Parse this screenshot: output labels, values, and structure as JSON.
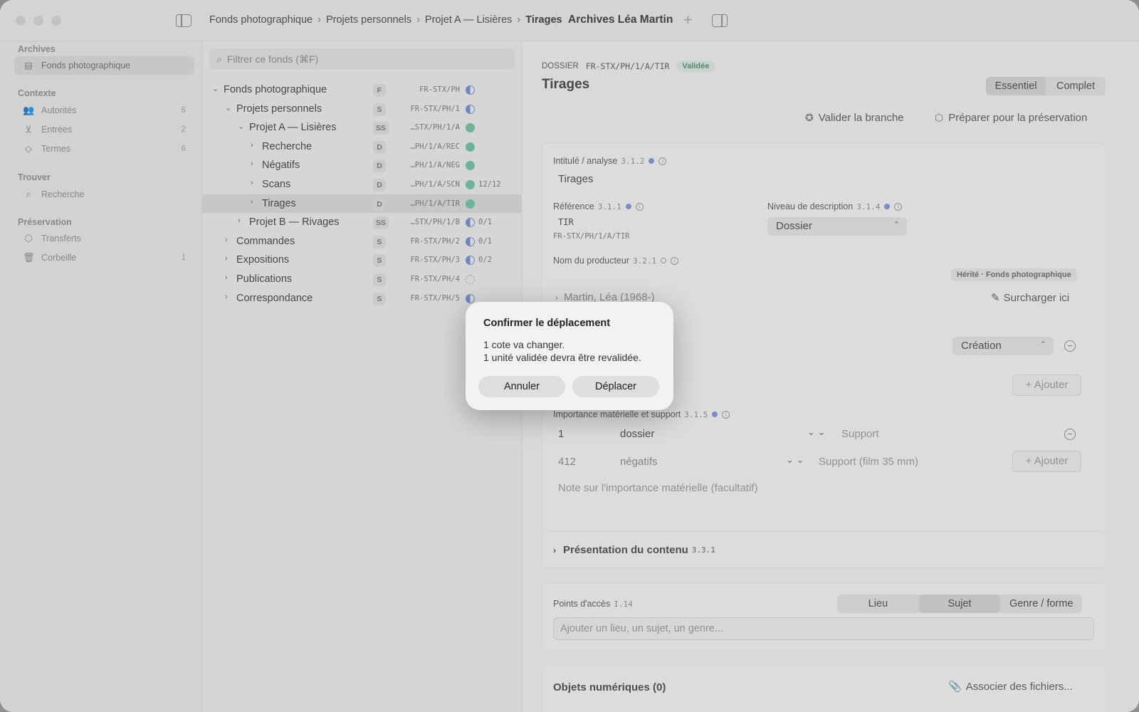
{
  "titlebar": {
    "breadcrumb": [
      "Fonds photographique",
      "Projets personnels",
      "Projet A — Lisières",
      "Tirages"
    ],
    "document_title": "Archives Léa Martin",
    "add_label": "+"
  },
  "sidebar": {
    "sections": [
      {
        "heading": "Archives",
        "items": [
          {
            "label": "Fonds photographique",
            "icon": "archive-box-icon",
            "count": "",
            "selected": true
          }
        ]
      },
      {
        "heading": "Contexte",
        "items": [
          {
            "label": "Autorités",
            "icon": "people-icon",
            "count": "6"
          },
          {
            "label": "Entrées",
            "icon": "inbox-tray-icon",
            "count": "2"
          },
          {
            "label": "Termes",
            "icon": "tag-icon",
            "count": "6"
          }
        ]
      },
      {
        "heading": "Trouver",
        "items": [
          {
            "label": "Recherche",
            "icon": "search-icon",
            "count": ""
          }
        ]
      },
      {
        "heading": "Préservation",
        "items": [
          {
            "label": "Transferts",
            "icon": "package-icon",
            "count": ""
          },
          {
            "label": "Corbeille",
            "icon": "trash-icon",
            "count": "1"
          }
        ]
      }
    ]
  },
  "tree": {
    "filter_placeholder": "Filtrer ce fonds (⌘F)",
    "rows": [
      {
        "label": "Fonds photographique",
        "level": "F",
        "cote": "FR-STX/PH",
        "status": "half",
        "progress": "",
        "depth": 0,
        "open": true
      },
      {
        "label": "Projets personnels",
        "level": "S",
        "cote": "FR-STX/PH/1",
        "status": "half",
        "progress": "",
        "depth": 1,
        "open": true
      },
      {
        "label": "Projet A — Lisières",
        "level": "SS",
        "cote": "…STX/PH/1/A",
        "status": "ok",
        "progress": "",
        "depth": 2,
        "open": true
      },
      {
        "label": "Recherche",
        "level": "D",
        "cote": "…PH/1/A/REC",
        "status": "ok",
        "progress": "",
        "depth": 3,
        "open": false
      },
      {
        "label": "Négatifs",
        "level": "D",
        "cote": "…PH/1/A/NEG",
        "status": "ok",
        "progress": "",
        "depth": 3,
        "open": false
      },
      {
        "label": "Scans",
        "level": "D",
        "cote": "…PH/1/A/SCN",
        "status": "ok",
        "progress": "12/12",
        "depth": 3,
        "open": false
      },
      {
        "label": "Tirages",
        "level": "D",
        "cote": "…PH/1/A/TIR",
        "status": "ok",
        "progress": "",
        "depth": 3,
        "open": false,
        "selected": true
      },
      {
        "label": "Projet B — Rivages",
        "level": "SS",
        "cote": "…STX/PH/1/B",
        "status": "half",
        "progress": "0/1",
        "depth": 2,
        "open": false
      },
      {
        "label": "Commandes",
        "level": "S",
        "cote": "FR-STX/PH/2",
        "status": "half",
        "progress": "0/1",
        "depth": 1,
        "open": false
      },
      {
        "label": "Expositions",
        "level": "S",
        "cote": "FR-STX/PH/3",
        "status": "half",
        "progress": "0/2",
        "depth": 1,
        "open": false
      },
      {
        "label": "Publications",
        "level": "S",
        "cote": "FR-STX/PH/4",
        "status": "none",
        "progress": "",
        "depth": 1,
        "open": false
      },
      {
        "label": "Correspondance",
        "level": "S",
        "cote": "FR-STX/PH/5",
        "status": "half",
        "progress": "",
        "depth": 1,
        "open": false
      }
    ]
  },
  "main": {
    "level_word": "DOSSIER",
    "cote": "FR-STX/PH/1/A/TIR",
    "badge": "Validée",
    "title": "Tirages",
    "view_modes": [
      "Essentiel",
      "Complet"
    ],
    "actions": {
      "validate": "Valider la branche",
      "prepare": "Préparer pour la préservation"
    },
    "fields": {
      "intitule_label": "Intitulé / analyse",
      "intitule_num": "3.1.2",
      "intitule_value": "Tirages",
      "reference_label": "Référence",
      "reference_num": "3.1.1",
      "reference_value": "TIR",
      "reference_full": "FR-STX/PH/1/A/TIR",
      "niveau_label": "Niveau de description",
      "niveau_num": "3.1.4",
      "niveau_value": "Dossier",
      "producteur_label": "Nom du producteur",
      "producteur_num": "3.2.1",
      "inherited": "Hérité · Fonds photographique",
      "producer_partial": "Martin, Léa (1968-)",
      "override": "Surcharger ici",
      "role_value": "Création",
      "add": "Ajouter",
      "importance_label": "Importance matérielle et support",
      "importance_num": "3.1.5",
      "extent": [
        {
          "qty": "1",
          "unit": "dossier",
          "support": "Support"
        },
        {
          "qty": "412",
          "unit": "négatifs",
          "support": "Support (film 35 mm)"
        }
      ],
      "extent_note": "Note sur l'importance matérielle (facultatif)"
    },
    "presentation": {
      "label": "Présentation du contenu",
      "num": "3.3.1"
    },
    "access": {
      "label": "Points d'accès",
      "num": "I.14",
      "tabs": [
        "Lieu",
        "Sujet",
        "Genre / forme"
      ],
      "placeholder": "Ajouter un lieu, un sujet, un genre..."
    },
    "digital": {
      "label": "Objets numériques (0)",
      "attach": "Associer des fichiers..."
    }
  },
  "dialog": {
    "title": "Confirmer le déplacement",
    "line1": "1 cote va changer.",
    "line2": "1 unité validée devra être revalidée.",
    "cancel": "Annuler",
    "confirm": "Déplacer"
  }
}
